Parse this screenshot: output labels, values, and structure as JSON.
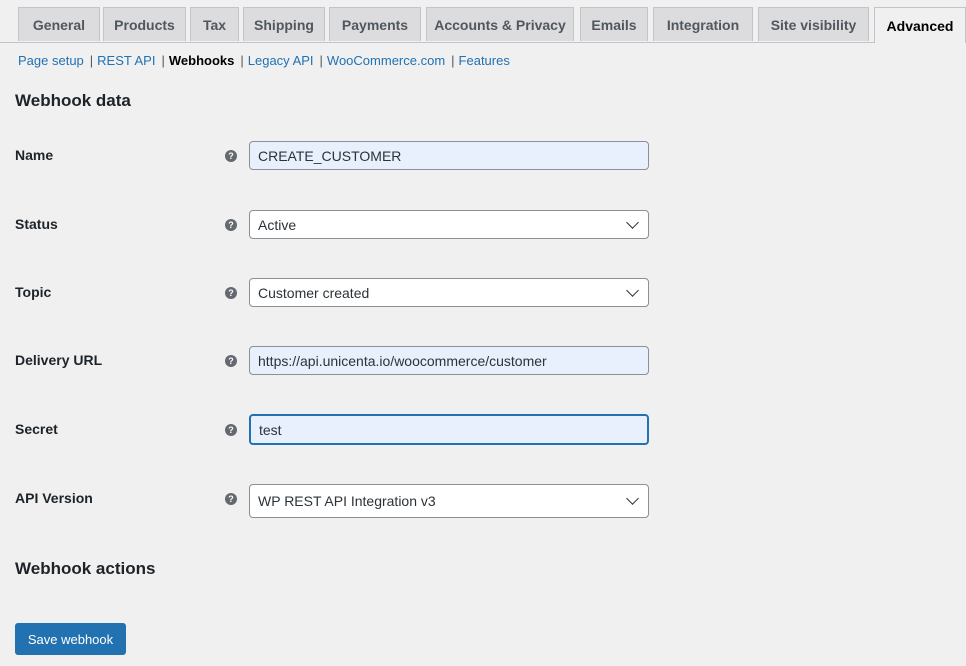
{
  "tabs": [
    {
      "label": "General"
    },
    {
      "label": "Products"
    },
    {
      "label": "Tax"
    },
    {
      "label": "Shipping"
    },
    {
      "label": "Payments"
    },
    {
      "label": "Accounts & Privacy"
    },
    {
      "label": "Emails"
    },
    {
      "label": "Integration"
    },
    {
      "label": "Site visibility"
    },
    {
      "label": "Advanced",
      "active": true
    }
  ],
  "subnav": [
    {
      "label": "Page setup"
    },
    {
      "label": "REST API"
    },
    {
      "label": "Webhooks",
      "current": true
    },
    {
      "label": "Legacy API"
    },
    {
      "label": "WooCommerce.com"
    },
    {
      "label": "Features"
    }
  ],
  "subnav_separator": "|",
  "section_title": "Webhook data",
  "help_glyph": "?",
  "fields": {
    "name": {
      "label": "Name",
      "value": "CREATE_CUSTOMER"
    },
    "status": {
      "label": "Status",
      "value": "Active"
    },
    "topic": {
      "label": "Topic",
      "value": "Customer created"
    },
    "delivery_url": {
      "label": "Delivery URL",
      "value": "https://api.unicenta.io/woocommerce/customer"
    },
    "secret": {
      "label": "Secret",
      "value": "test"
    },
    "api_version": {
      "label": "API Version",
      "value": "WP REST API Integration v3"
    }
  },
  "actions_title": "Webhook actions",
  "save_button": "Save webhook",
  "colors": {
    "accent": "#2271b1",
    "autofill": "#e8f0fe",
    "background": "#f0f0f1"
  }
}
